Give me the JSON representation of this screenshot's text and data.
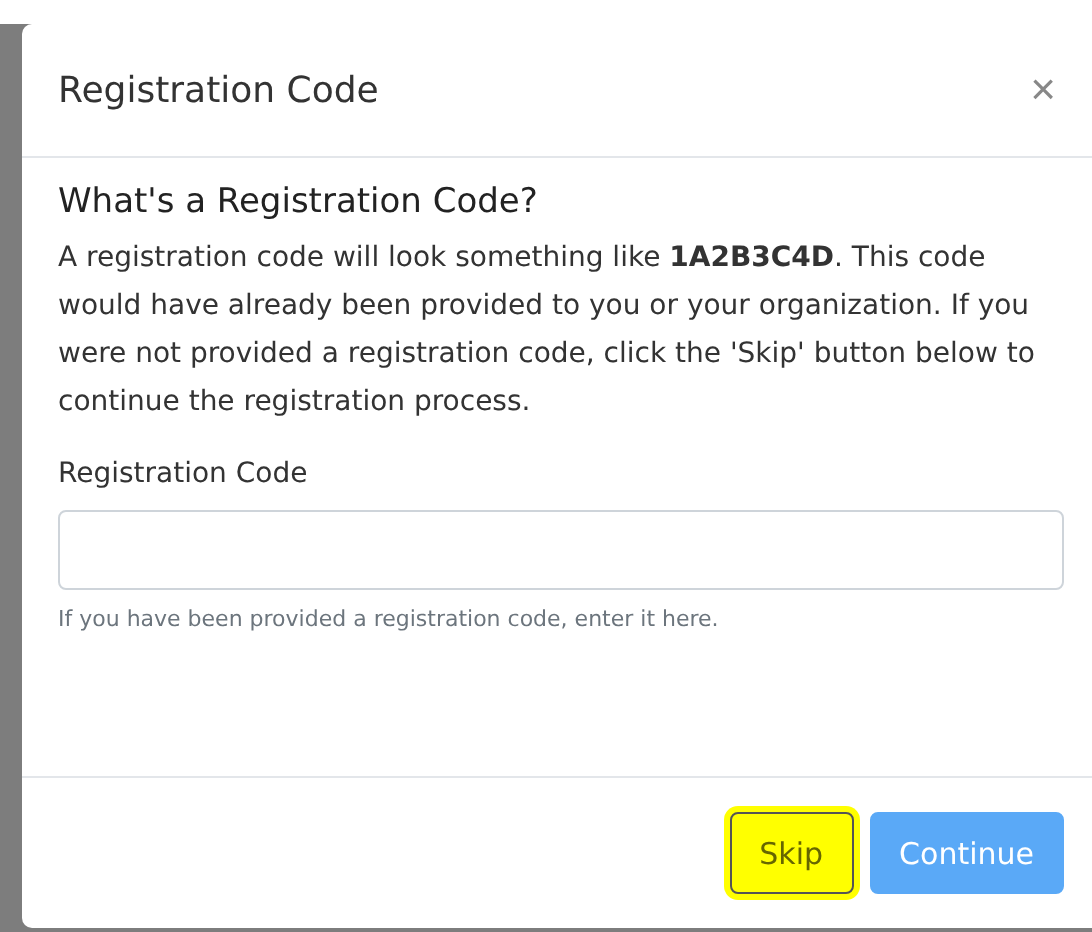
{
  "modal": {
    "title": "Registration Code",
    "close": "×"
  },
  "heading": "What's a Registration Code?",
  "description": "A registration code will look something like **1A2B3C4D**. This code would have already been provided to you or your organization. If you were not provided a registration code, click the 'Skip' button below to continue the registration process.",
  "field": {
    "label": "Registration Code",
    "help": "If you have been provided a registration code, enter it here."
  },
  "buttons": [
    {
      "label": "Skip",
      "kind": "secondary",
      "highlighted": true
    },
    {
      "label": "Continue",
      "kind": "primary",
      "highlighted": false
    }
  ]
}
